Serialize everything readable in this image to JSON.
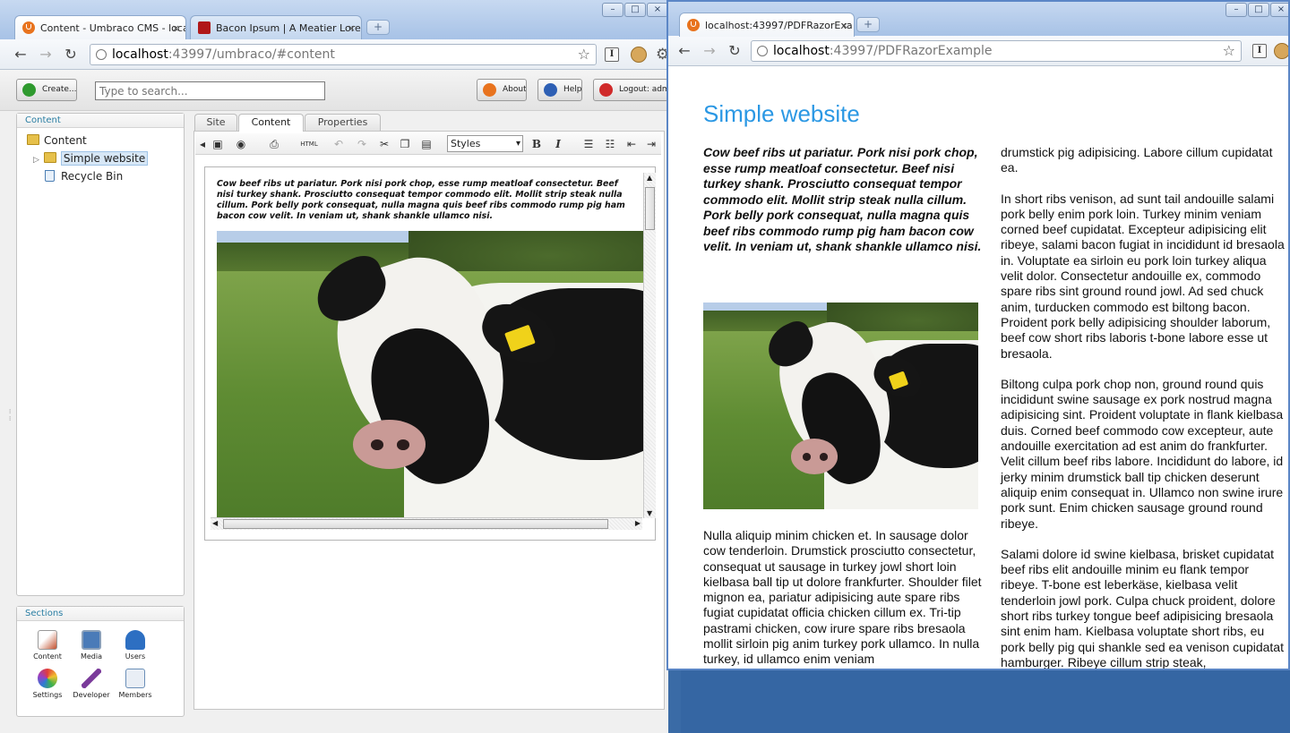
{
  "umbraco_window": {
    "tabs": [
      {
        "label": "Content - Umbraco CMS - local",
        "active": true
      },
      {
        "label": "Bacon Ipsum | A Meatier Loren",
        "active": false
      }
    ],
    "url_host": "localhost",
    "url_rest": ":43997/umbraco/#content",
    "toolbar": {
      "create_label": "Create...",
      "search_placeholder": "Type to search...",
      "about_label": "About",
      "help_label": "Help",
      "logout_label": "Logout: admi"
    },
    "content_panel": {
      "title": "Content",
      "tree": [
        {
          "label": "Content",
          "icon": "folder-icon"
        },
        {
          "label": "Simple website",
          "icon": "folder-icon",
          "selected": true
        },
        {
          "label": "Recycle Bin",
          "icon": "recycle-bin-icon"
        }
      ]
    },
    "sections_panel": {
      "title": "Sections",
      "items": [
        {
          "label": "Content",
          "icon": "content-section-icon",
          "color": "#c2502e"
        },
        {
          "label": "Media",
          "icon": "media-section-icon",
          "color": "#4a7bb8"
        },
        {
          "label": "Users",
          "icon": "users-section-icon",
          "color": "#2d6fc2"
        },
        {
          "label": "Settings",
          "icon": "settings-section-icon",
          "color": "#d8a622"
        },
        {
          "label": "Developer",
          "icon": "developer-section-icon",
          "color": "#7a3a9a"
        },
        {
          "label": "Members",
          "icon": "members-section-icon",
          "color": "#6b8fb8"
        }
      ]
    },
    "editor": {
      "tabs": [
        "Site",
        "Content",
        "Properties"
      ],
      "active_tab": "Content",
      "styles_label": "Styles",
      "html_label": "HTML",
      "body_text": "Cow beef ribs ut pariatur. Pork nisi pork chop, esse rump meatloaf consectetur. Beef nisi turkey shank. Prosciutto consequat tempor commodo elit. Mollit strip steak nulla cillum. Pork belly pork consequat, nulla magna quis beef ribs commodo rump pig ham bacon cow velit. In veniam ut, shank shankle ullamco nisi."
    }
  },
  "pdf_window": {
    "tab_label": "localhost:43997/PDFRazorExa",
    "url_host": "localhost",
    "url_rest": ":43997/PDFRazorExample",
    "page": {
      "title": "Simple website",
      "intro": "Cow beef ribs ut pariatur. Pork nisi pork chop, esse rump meatloaf consectetur. Beef nisi turkey shank. Prosciutto consequat tempor commodo elit. Mollit strip steak nulla cillum. Pork belly pork consequat, nulla magna quis beef ribs commodo rump pig ham bacon cow velit. In veniam ut, shank shankle ullamco nisi.",
      "left_paragraph": "Nulla aliquip minim chicken et. In sausage dolor cow tenderloin. Drumstick prosciutto consectetur, consequat ut sausage in turkey jowl short loin kielbasa ball tip ut dolore frankfurter. Shoulder filet mignon ea, pariatur adipisicing aute spare ribs fugiat cupidatat officia chicken cillum ex. Tri-tip pastrami chicken, cow irure spare ribs bresaola mollit sirloin pig anim turkey pork ullamco. In nulla turkey, id ullamco enim veniam",
      "right_paragraphs": [
        "drumstick pig adipisicing. Labore cillum cupidatat ea.",
        "In short ribs venison, ad sunt tail andouille salami pork belly enim pork loin. Turkey minim veniam corned beef cupidatat. Excepteur adipisicing elit ribeye, salami bacon fugiat in incididunt id bresaola in. Voluptate ea sirloin eu pork loin turkey aliqua velit dolor. Consectetur andouille ex, commodo spare ribs sint ground round jowl. Ad sed chuck anim, turducken commodo est biltong bacon. Proident pork belly adipisicing shoulder laborum, beef cow short ribs laboris t-bone labore esse ut bresaola.",
        "Biltong culpa pork chop non, ground round quis incididunt swine sausage ex pork nostrud magna adipisicing sint. Proident voluptate in flank kielbasa duis. Corned beef commodo cow excepteur, aute andouille exercitation ad est anim do frankfurter. Velit cillum beef ribs labore. Incididunt do labore, id jerky minim drumstick ball tip chicken deserunt aliquip enim consequat in. Ullamco non swine irure pork sunt. Enim chicken sausage ground round ribeye.",
        "Salami dolore id swine kielbasa, brisket cupidatat beef ribs elit andouille minim eu flank tempor ribeye. T-bone est leberkäse, kielbasa velit tenderloin jowl pork. Culpa chuck proident, dolore short ribs turkey tongue beef adipisicing bresaola sint enim ham. Kielbasa voluptate short ribs, eu pork belly pig qui shankle sed ea venison cupidatat hamburger. Ribeye cillum strip steak,"
      ]
    }
  },
  "colors": {
    "title_blue": "#2b98e4",
    "chrome_frame": "#a7c2e6",
    "desktop": "#3a6ba6"
  }
}
